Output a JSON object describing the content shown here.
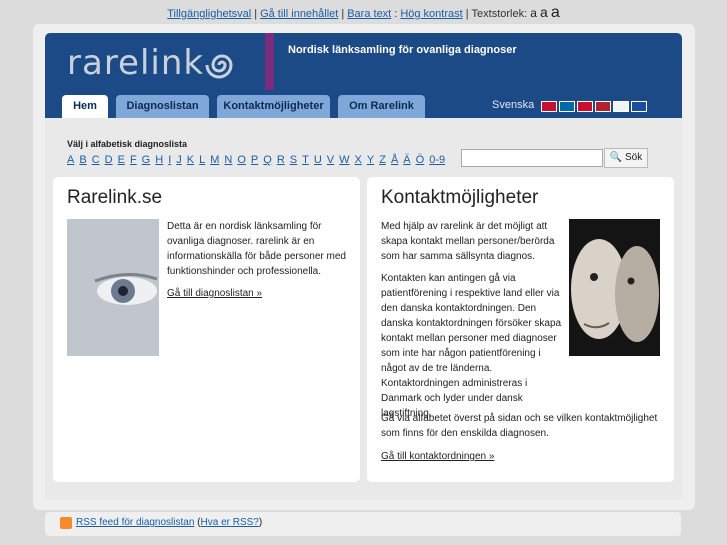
{
  "topbar": {
    "accessibility": "Tillgänglighetsval",
    "skip_content": "Gå till innehållet",
    "text_only": "Bara text",
    "high_contrast": "Hög kontrast",
    "text_size_label": "Textstorlek:",
    "size_small": "a",
    "size_medium": "a",
    "size_large": "a"
  },
  "header": {
    "logo_text": "rarelink",
    "tagline": "Nordisk länksamling för ovanliga diagnoser",
    "tabs": [
      "Hem",
      "Diagnoslistan",
      "Kontaktmöjligheter",
      "Om Rarelink"
    ],
    "language": "Svenska"
  },
  "alphabet": {
    "title": "Välj i alfabetisk diagnoslista",
    "letters": [
      "A",
      "B",
      "C",
      "D",
      "E",
      "F",
      "G",
      "H",
      "I",
      "J",
      "K",
      "L",
      "M",
      "N",
      "O",
      "P",
      "Q",
      "R",
      "S",
      "T",
      "U",
      "V",
      "W",
      "X",
      "Y",
      "Z",
      "Å",
      "Ä",
      "Ö",
      "0-9"
    ]
  },
  "search": {
    "placeholder": "",
    "button": "Sök"
  },
  "card_left": {
    "title": "Rarelink.se",
    "body": "Detta är en nordisk länksamling för ovanliga diagnoser. rarelink är en informationskälla för både personer med funktionshinder och professionella.",
    "link": "Gå till diagnoslistan »"
  },
  "card_right": {
    "title": "Kontaktmöjligheter",
    "p1": "Med hjälp av rarelink är det möjligt att skapa kontakt mellan personer/berörda som har samma sällsynta diagnos.",
    "p2": "Kontakten kan antingen gå via patientförening i respektive land eller via den danska kontaktordningen. Den danska kontaktordningen försöker skapa kontakt mellan personer med diagnoser som inte har någon patientförening i något av de tre länderna. Kontaktordningen administreras i Danmark och lyder under dansk lagstiftning.",
    "p3": "Gå via alfabetet överst på sidan och se vilken kontaktmöjlighet som finns för den enskilda diagnosen.",
    "link": "Gå till kontaktordningen »"
  },
  "footer": {
    "rss": "RSS feed för diagnoslistan",
    "rss_help": "Hva er RSS?"
  }
}
